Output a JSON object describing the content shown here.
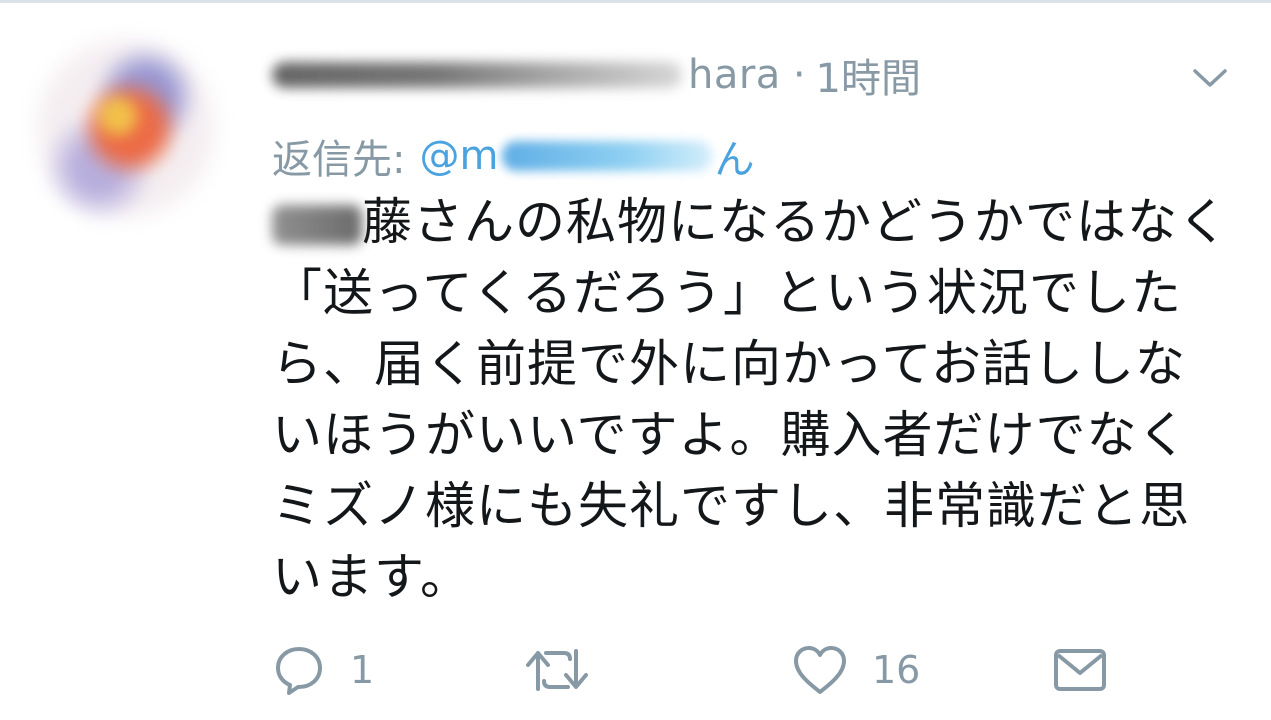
{
  "tweet": {
    "author_suffix": "hara",
    "separator": "·",
    "time": "1時間",
    "reply_label": "返信先:",
    "reply_at": "@m",
    "reply_suffix": "ん",
    "name_suffix": "藤さん",
    "body_lines": [
      "の私物になるかどうかではなく",
      "「送ってくるだろう」という状況でした",
      "ら、届く前提で外に向かってお話ししな",
      "いほうがいいですよ。購入者だけでなく",
      "ミズノ様にも失礼ですし、非常識だと思",
      "います。"
    ]
  },
  "actions": {
    "reply_count": "1",
    "like_count": "16"
  },
  "icons": {
    "menu": "chevron-down-icon",
    "reply": "reply-bubble-icon",
    "retweet": "retweet-icon",
    "like": "heart-icon",
    "share": "envelope-icon"
  },
  "colors": {
    "meta_text": "#8899a6",
    "link": "#4aa3df",
    "body_text": "#14171a"
  }
}
